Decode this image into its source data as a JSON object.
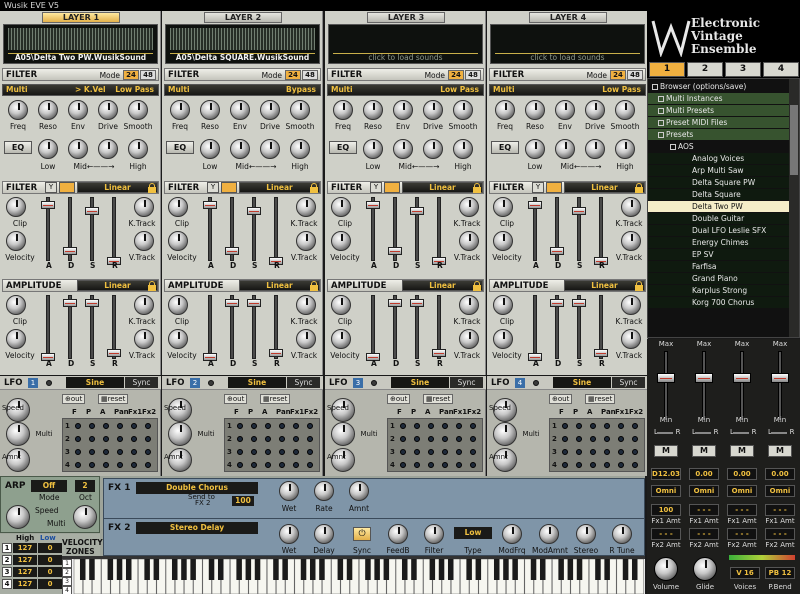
{
  "app": {
    "title": "Wusik EVE V5"
  },
  "layers": [
    {
      "tab": "LAYER 1",
      "sound": "A05\\Delta Two PW.WusikSound",
      "filter_type": "Multi",
      "filter_mod": "> K.Vel",
      "filter_pass": "Low Pass",
      "filter_env_curve": "Linear",
      "amp_curve": "Linear",
      "lfo_num": "1"
    },
    {
      "tab": "LAYER 2",
      "sound": "A05\\Delta SQUARE.WusikSound",
      "filter_type": "Multi",
      "filter_mod": "",
      "filter_pass": "Bypass",
      "filter_env_curve": "Linear",
      "amp_curve": "Linear",
      "lfo_num": "2"
    },
    {
      "tab": "LAYER 3",
      "sound": "click to load sounds",
      "filter_type": "Multi",
      "filter_mod": "",
      "filter_pass": "Low Pass",
      "filter_env_curve": "Linear",
      "amp_curve": "Linear",
      "lfo_num": "3"
    },
    {
      "tab": "LAYER 4",
      "sound": "click to load sounds",
      "filter_type": "Multi",
      "filter_mod": "",
      "filter_pass": "Low Pass",
      "filter_env_curve": "Linear",
      "amp_curve": "Linear",
      "lfo_num": "4"
    }
  ],
  "labels": {
    "filter": "FILTER",
    "mode": "Mode",
    "mode_24": "24",
    "mode_48": "48",
    "freq": "Freq",
    "reso": "Reso",
    "env": "Env",
    "drive": "Drive",
    "smooth": "Smooth",
    "eq": "EQ",
    "low": "Low",
    "mid": "Mid←——→",
    "high": "High",
    "clip": "Clip",
    "velocity": "Velocity",
    "ktrack": "K.Track",
    "vtrack": "V.Track",
    "a": "A",
    "d": "D",
    "s": "S",
    "r": "R",
    "amplitude": "AMPLITUDE",
    "y_glyph": "Y",
    "lfo": "LFO",
    "lfo_wave": "Sine",
    "lfo_sync": "Sync",
    "out": "out",
    "reset": "reset",
    "speed": "Speed",
    "multi": "Multi",
    "amnt": "Amnt",
    "grid_heads": [
      "F",
      "P",
      "A",
      "Pan",
      "Fx1",
      "Fx2"
    ],
    "grid_rows": [
      "1",
      "2",
      "3",
      "4"
    ]
  },
  "arp": {
    "label": "ARP",
    "value": "Off",
    "oct_value": "2",
    "mode": "Mode",
    "oct": "Oct",
    "speed": "Speed",
    "multi": "Multi"
  },
  "fx": {
    "fx1_label": "FX 1",
    "fx1_name": "Double Chorus",
    "send_to": "Send to",
    "fx2_target": "FX 2",
    "send_value": "100",
    "wet": "Wet",
    "rate": "Rate",
    "amnt": "Amnt",
    "fx2_label": "FX 2",
    "fx2_name": "Stereo Delay",
    "delay": "Delay",
    "sync": "Sync",
    "feedb": "FeedB",
    "filter": "Filter",
    "type_value": "Low",
    "type": "Type",
    "modfrq": "ModFrq",
    "modamnt": "ModAmnt",
    "stereo": "Stereo",
    "rtune": "R Tune"
  },
  "zones": {
    "high": "High",
    "low": "Low",
    "title_1": "VELOCITY",
    "title_2": "ZONES",
    "rows": [
      {
        "n": "1",
        "high": "127",
        "low": "0"
      },
      {
        "n": "2",
        "high": "127",
        "low": "0"
      },
      {
        "n": "3",
        "high": "127",
        "low": "0"
      },
      {
        "n": "4",
        "high": "127",
        "low": "0"
      }
    ],
    "oct_buttons": [
      "1",
      "2",
      "3",
      "4"
    ]
  },
  "brand": {
    "line1": "Electronic",
    "line2": "Vintage",
    "line3": "Ensemble"
  },
  "preset_tabs": [
    "1",
    "2",
    "3",
    "4"
  ],
  "browser": {
    "root": "Browser (options/save)",
    "items": [
      "Multi Instances",
      "Multi Presets",
      "Preset MIDI Files",
      "Presets"
    ],
    "sub": "AOS",
    "presets": [
      "Analog Voices",
      "Arp Multi Saw",
      "Delta Square PW",
      "Delta Square",
      "Delta Two PW",
      "Double Guitar",
      "Dual LFO Leslie SFX",
      "Energy Chimes",
      "EP SV",
      "Farfisa",
      "Grand Piano",
      "Karplus Strong",
      "Korg 700 Chorus"
    ]
  },
  "mixer": {
    "max": "Max",
    "min": "Min",
    "l": "L",
    "r": "R",
    "m": "M",
    "fine": [
      "D12.03",
      "0.00",
      "0.00",
      "0.00"
    ],
    "omni": "Omni",
    "fx1_vals": [
      "100",
      "- - -",
      "- - -",
      "- - -"
    ],
    "fx2_vals": [
      "- - -",
      "- - -",
      "- - -",
      "- - -"
    ],
    "fx1_amt": "Fx1 Amt",
    "fx2_amt": "Fx2 Amt",
    "volume": "Volume",
    "glide": "Glide",
    "voices_value": "V 16",
    "voices": "Voices",
    "pb_value": "PB 12",
    "pbend": "P.Bend"
  },
  "colors": {
    "accent": "#f0b040",
    "lcd_text": "#f0c040",
    "lfo_blue": "#3a6ea8"
  }
}
